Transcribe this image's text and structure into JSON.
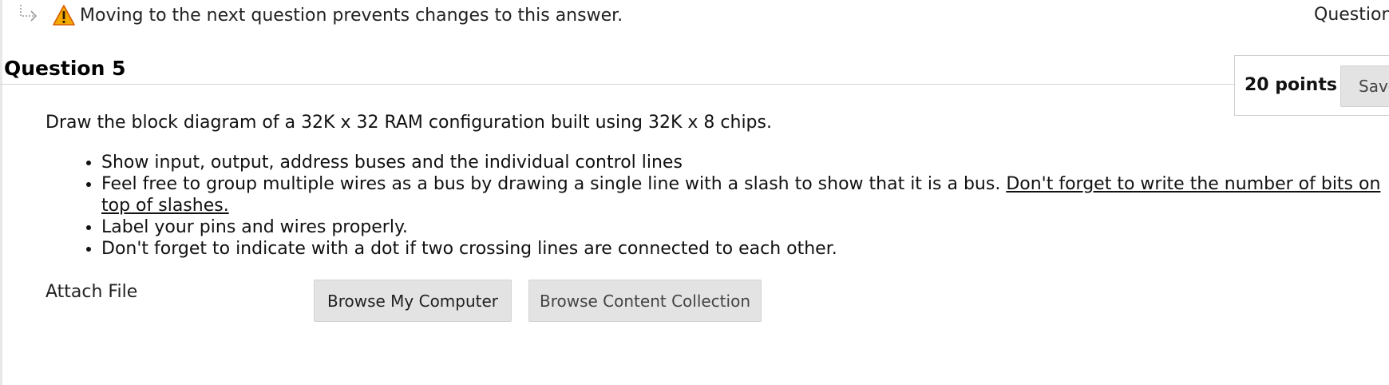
{
  "notice": {
    "branch_icon": "arrow-branch-icon",
    "warning_icon": "warning-triangle-icon",
    "warning_icon_color": "#f2a900",
    "text": "Moving to the next question prevents changes to this answer."
  },
  "nav": {
    "question_link_partial": "Question"
  },
  "question": {
    "title": "Question 5",
    "points": "20 points",
    "save_label": "Save",
    "prompt": "Draw the block diagram of a 32K x 32 RAM configuration built using 32K x 8 chips.",
    "bullets": [
      {
        "text": "Show input, output, address buses and the individual control lines"
      },
      {
        "text": "Feel free to group multiple wires as a bus by drawing a single line with a slash to show that it is a bus. ",
        "underlined_text": "Don't forget to write the number of bits on top of slashes."
      },
      {
        "text": "Label your pins and wires properly."
      },
      {
        "text": "Don't forget to indicate with a dot if two crossing lines are connected to each other."
      }
    ]
  },
  "attach": {
    "label": "Attach File",
    "browse_computer_label": "Browse My Computer",
    "browse_collection_label": "Browse Content Collection"
  }
}
